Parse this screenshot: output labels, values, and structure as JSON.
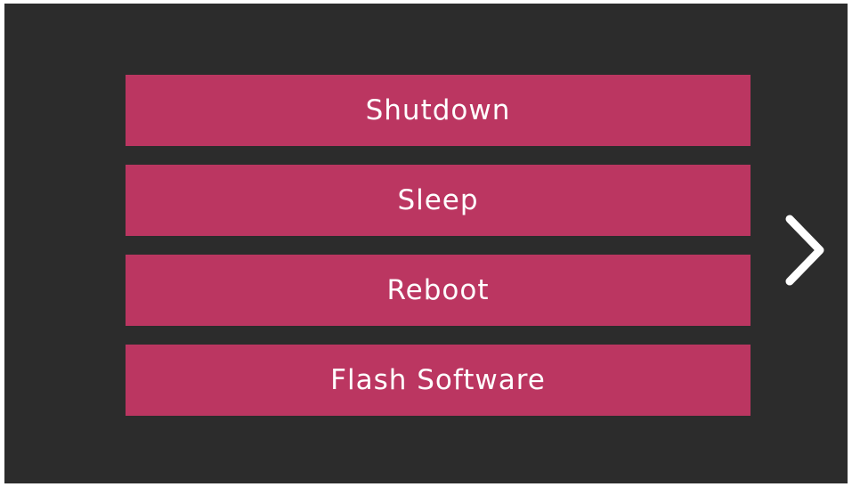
{
  "menu": {
    "items": [
      {
        "label": "Shutdown"
      },
      {
        "label": "Sleep"
      },
      {
        "label": "Reboot"
      },
      {
        "label": "Flash Software"
      }
    ]
  },
  "navigation": {
    "next_icon": "chevron-right-icon"
  },
  "colors": {
    "background": "#2c2c2c",
    "button": "#bb3661",
    "text": "#ffffff"
  }
}
